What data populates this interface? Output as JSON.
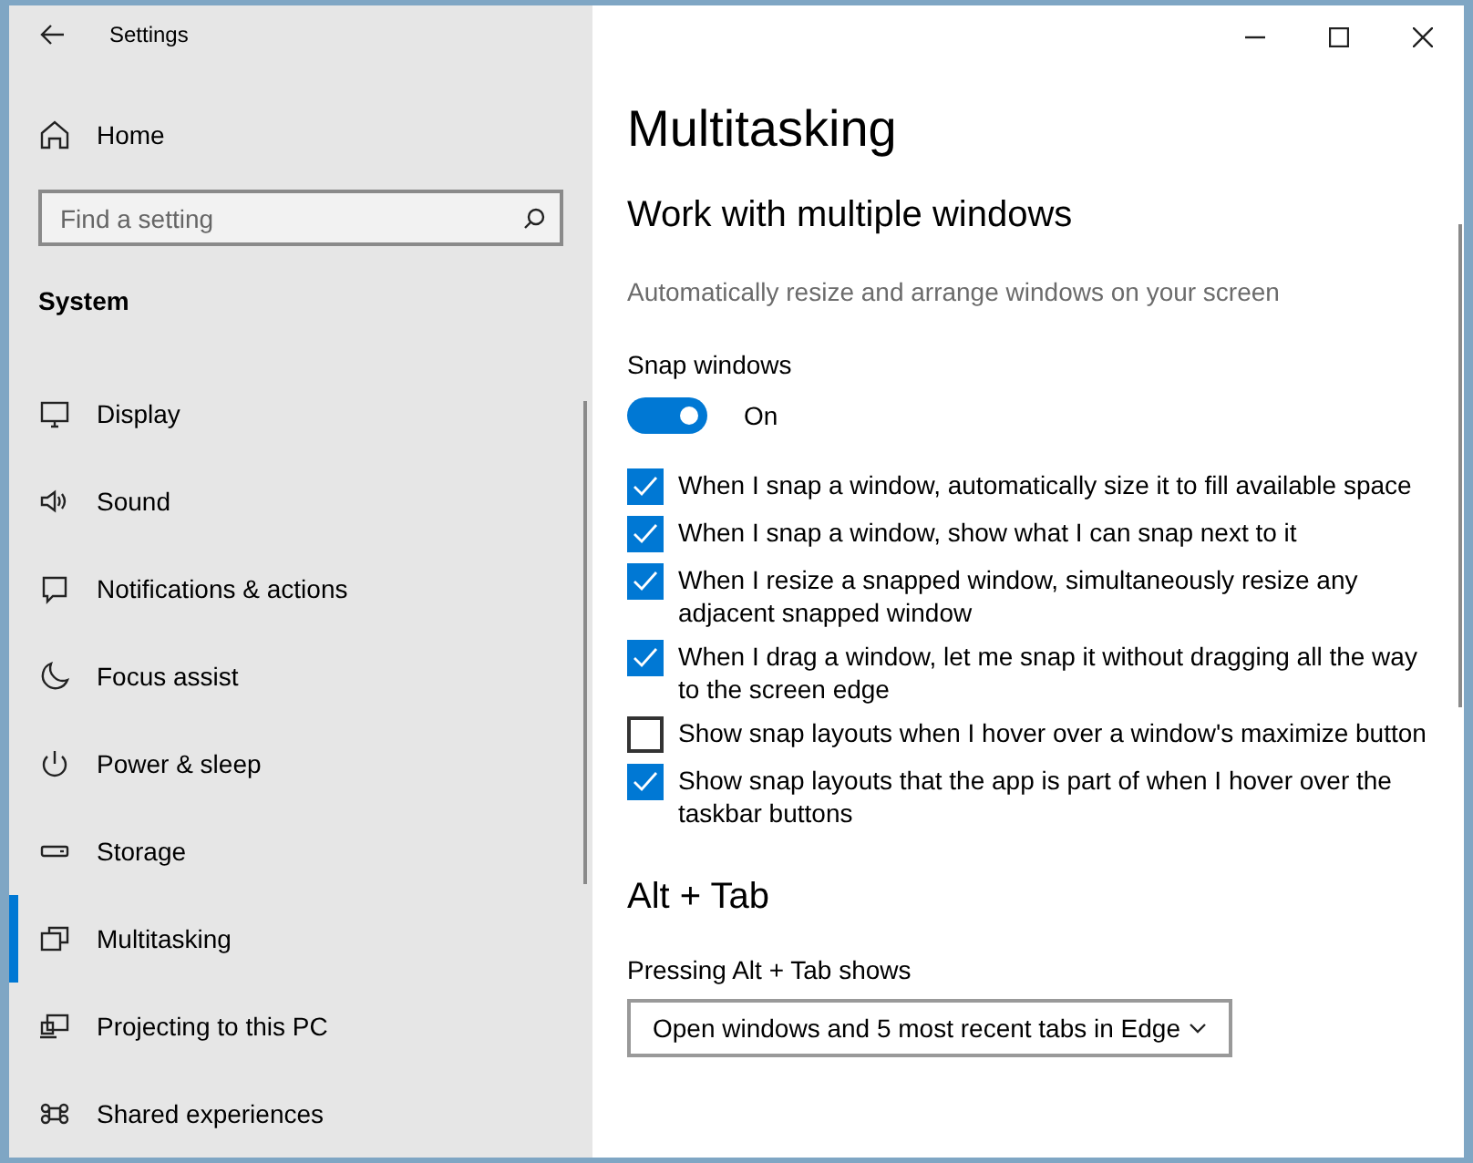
{
  "window": {
    "title": "Settings"
  },
  "sidebar": {
    "home": "Home",
    "search": {
      "placeholder": "Find a setting"
    },
    "section": "System",
    "items": [
      {
        "label": "Display",
        "selected": false
      },
      {
        "label": "Sound",
        "selected": false
      },
      {
        "label": "Notifications & actions",
        "selected": false
      },
      {
        "label": "Focus assist",
        "selected": false
      },
      {
        "label": "Power & sleep",
        "selected": false
      },
      {
        "label": "Storage",
        "selected": false
      },
      {
        "label": "Multitasking",
        "selected": true
      },
      {
        "label": "Projecting to this PC",
        "selected": false
      },
      {
        "label": "Shared experiences",
        "selected": false
      }
    ]
  },
  "page": {
    "title": "Multitasking",
    "sections": [
      {
        "heading": "Work with multiple windows",
        "description": "Automatically resize and arrange windows on your screen",
        "toggle": {
          "label": "Snap windows",
          "on": true,
          "state_label": "On"
        },
        "options": [
          {
            "label": "When I snap a window, automatically size it to fill available space",
            "checked": true
          },
          {
            "label": "When I snap a window, show what I can snap next to it",
            "checked": true
          },
          {
            "label": "When I resize a snapped window, simultaneously resize any adjacent snapped window",
            "checked": true
          },
          {
            "label": "When I drag a window, let me snap it without dragging all the way to the screen edge",
            "checked": true
          },
          {
            "label": "Show snap layouts when I hover over a window's maximize button",
            "checked": false
          },
          {
            "label": "Show snap layouts that the app is part of when I hover over the taskbar buttons",
            "checked": true
          }
        ]
      },
      {
        "heading": "Alt + Tab",
        "dropdown": {
          "label": "Pressing Alt + Tab shows",
          "value": "Open windows and 5 most recent tabs in Edge"
        }
      }
    ]
  }
}
